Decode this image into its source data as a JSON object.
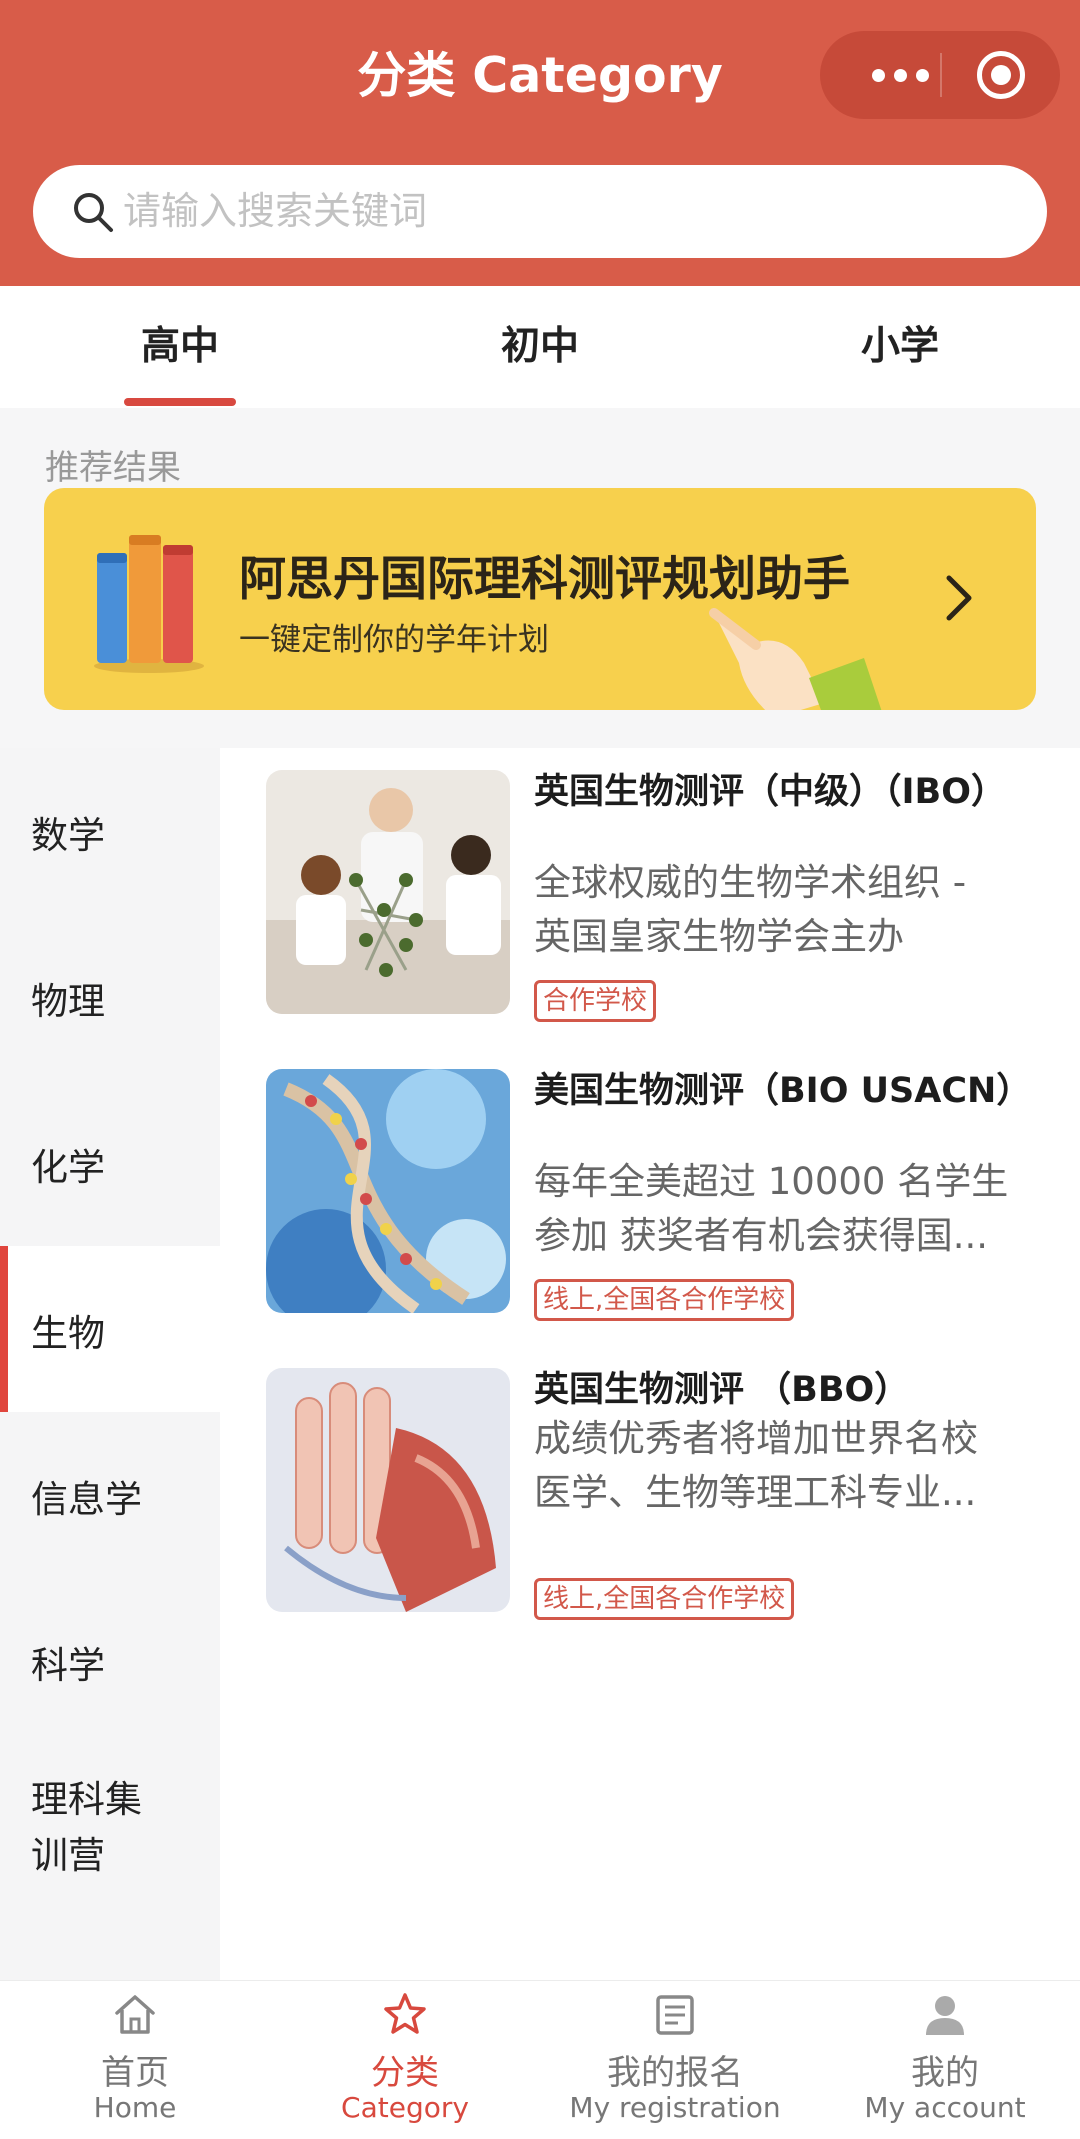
{
  "header": {
    "title": "分类 Category",
    "search_placeholder": "请输入搜索关键词"
  },
  "tabs": [
    {
      "label": "高中",
      "active": true
    },
    {
      "label": "初中",
      "active": false
    },
    {
      "label": "小学",
      "active": false
    }
  ],
  "recommend": {
    "section_title": "推荐结果",
    "banner_title": "阿思丹国际理科测评规划助手",
    "banner_subtitle": "一键定制你的学年计划"
  },
  "sidebar": {
    "items": [
      {
        "label": "数学"
      },
      {
        "label": "物理"
      },
      {
        "label": "化学"
      },
      {
        "label": "生物",
        "active": true
      },
      {
        "label": "信息学"
      },
      {
        "label": "科学"
      },
      {
        "label": "理科集训营"
      }
    ]
  },
  "courses": [
    {
      "title": "英国生物测评（中级）（IBO）",
      "desc_line1": "全球权威的生物学术组织 -",
      "desc_line2": "英国皇家生物学会主办",
      "tag": "合作学校"
    },
    {
      "title": "美国生物测评（BIO USACN）",
      "desc_line1": "每年全美超过 10000 名学生",
      "desc_line2": "参加 获奖者有机会获得国...",
      "tag": "线上,全国各合作学校"
    },
    {
      "title": "英国生物测评 （BBO）",
      "desc_line1": "成绩优秀者将增加世界名校",
      "desc_line2": "医学、生物等理工科专业...",
      "tag": "线上,全国各合作学校"
    }
  ],
  "bottom_nav": [
    {
      "cn": "首页",
      "en": "Home",
      "icon": "home-icon"
    },
    {
      "cn": "分类",
      "en": "Category",
      "icon": "star-icon",
      "active": true
    },
    {
      "cn": "我的报名",
      "en": "My registration",
      "icon": "document-icon"
    },
    {
      "cn": "我的",
      "en": "My account",
      "icon": "person-icon"
    }
  ],
  "colors": {
    "brand_red": "#d85c49",
    "banner_yellow": "#f7d04d",
    "active_red": "#d8493e"
  }
}
